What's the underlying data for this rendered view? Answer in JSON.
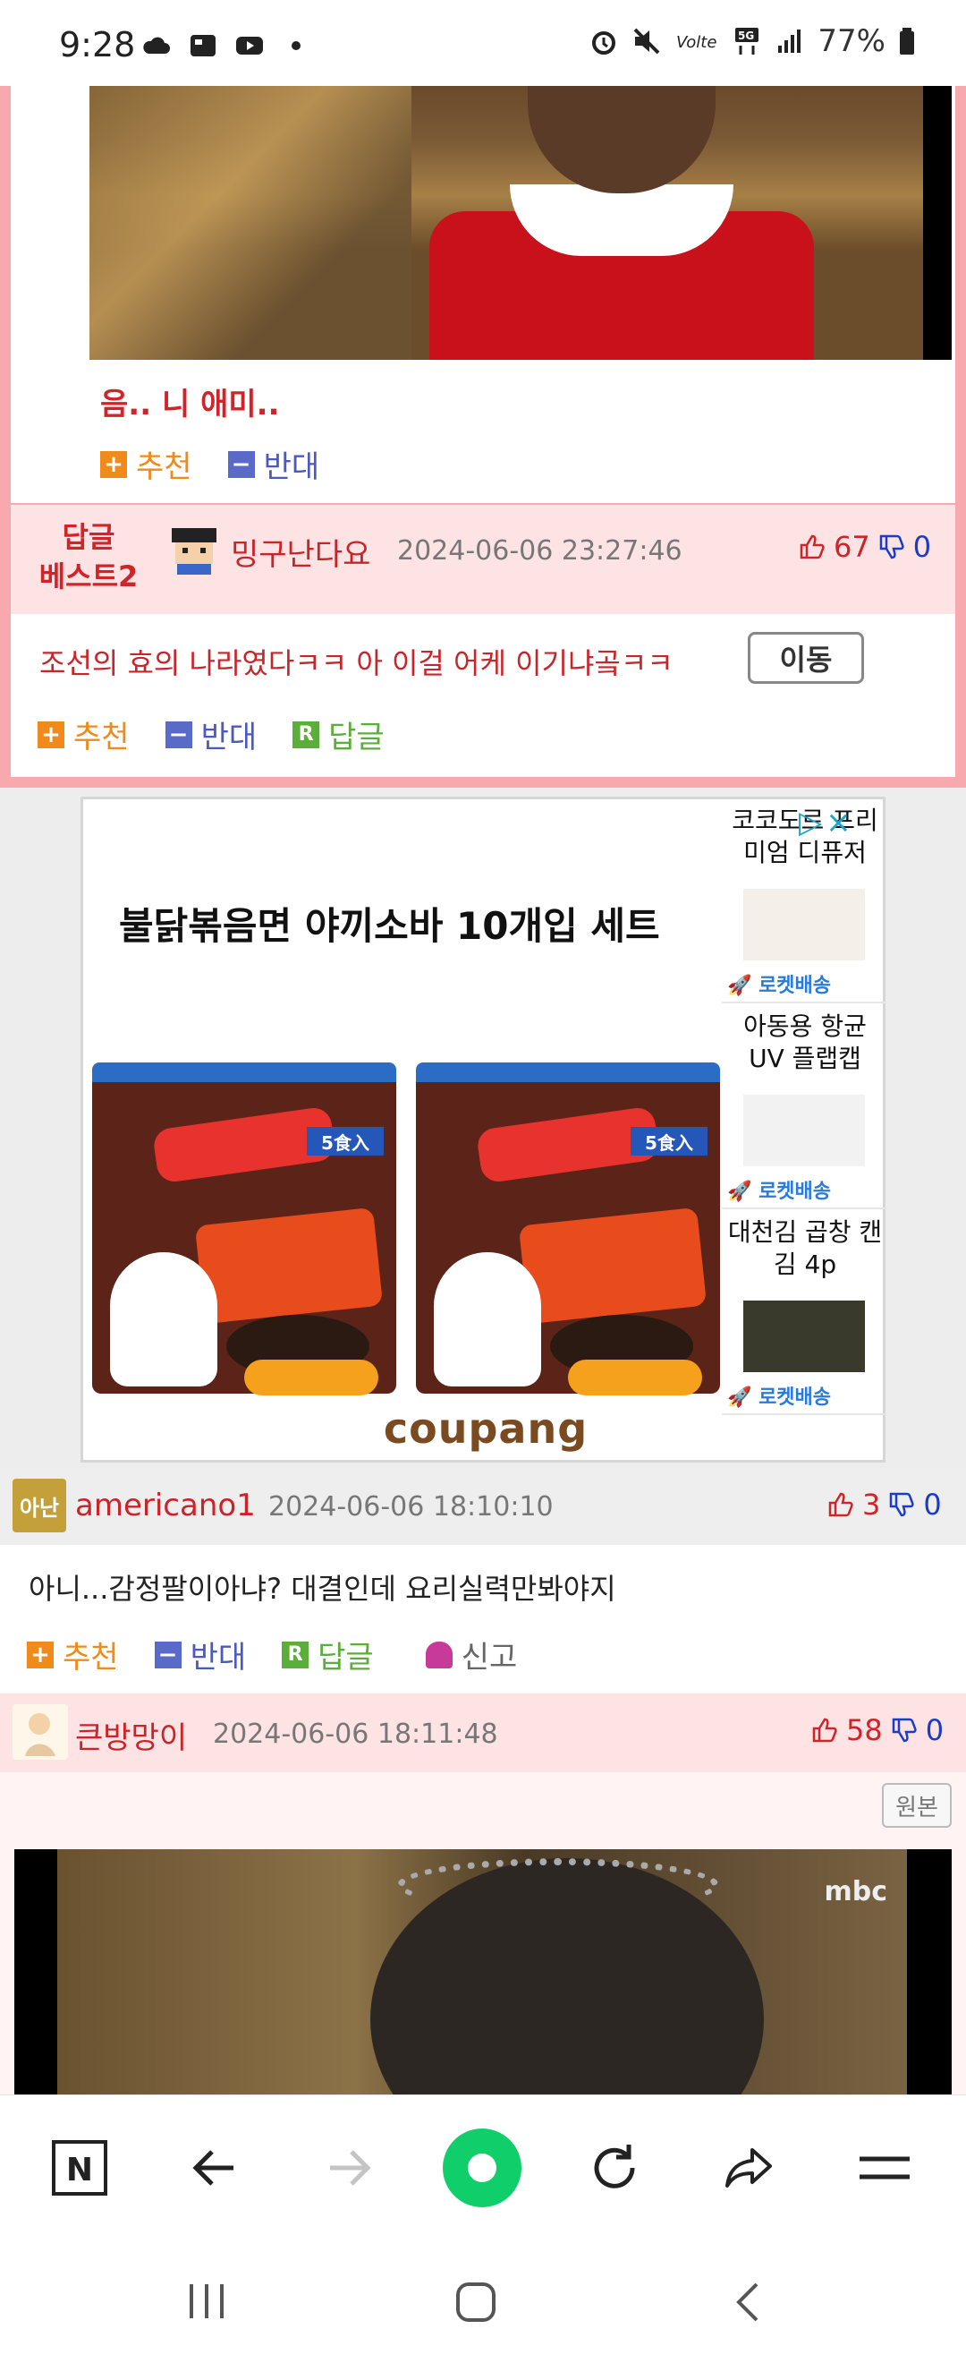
{
  "status_bar": {
    "time": "9:28",
    "battery": "77%"
  },
  "best_comment": {
    "caption": "음.. 니 애미..",
    "votes": {
      "up": "추천",
      "down": "반대"
    },
    "badge_line1": "답글",
    "badge_line2": "베스트2",
    "user": "밍구난다요",
    "date": "2024-06-06 23:27:46",
    "likes": "67",
    "dislikes": "0",
    "text": "조선의 효의 나라였다ㅋㅋ 아 이걸 어케 이기냐곸ㅋㅋ",
    "move_button": "이동",
    "actions": {
      "up": "추천",
      "down": "반대",
      "reply": "답글",
      "reply_icon": "R"
    }
  },
  "ad": {
    "title": "불닭볶음면 야끼소바 10개입 세트",
    "pack_badge": "5食入",
    "side_items": [
      {
        "title": "코코도르 프리미엄 디퓨저"
      },
      {
        "title": "아동용 항균 UV 플랩캡"
      },
      {
        "title": "대천김 곱창 캔김 4p"
      }
    ],
    "rocket_label": "로켓배송",
    "brand": "coupang",
    "close_icon": "×",
    "ad_icon": "▷"
  },
  "comments": [
    {
      "user": "americano1",
      "avatar_text": "아난",
      "date": "2024-06-06 18:10:10",
      "likes": "3",
      "dislikes": "0",
      "text": "아니...감정팔이아냐? 대결인데 요리실력만봐야지",
      "actions": {
        "up": "추천",
        "down": "반대",
        "reply": "답글",
        "report": "신고",
        "reply_icon": "R"
      }
    },
    {
      "user": "큰방망이",
      "date": "2024-06-06 18:11:48",
      "likes": "58",
      "dislikes": "0",
      "original_button": "원본",
      "video_watermark": "mbc"
    }
  ],
  "toolbar": {
    "items": [
      "naver-icon",
      "back-icon",
      "forward-icon",
      "home-icon",
      "refresh-icon",
      "share-icon",
      "menu-icon"
    ],
    "naver_letter": "N"
  },
  "colors": {
    "accent_red": "#d0242a",
    "pink_border": "#f8a9ad",
    "pink_bg": "#fde3e4",
    "plus_orange": "#f08a1b",
    "minus_blue": "#5a6ac8",
    "reply_green": "#5cae3b",
    "home_green": "#10cf6a"
  }
}
